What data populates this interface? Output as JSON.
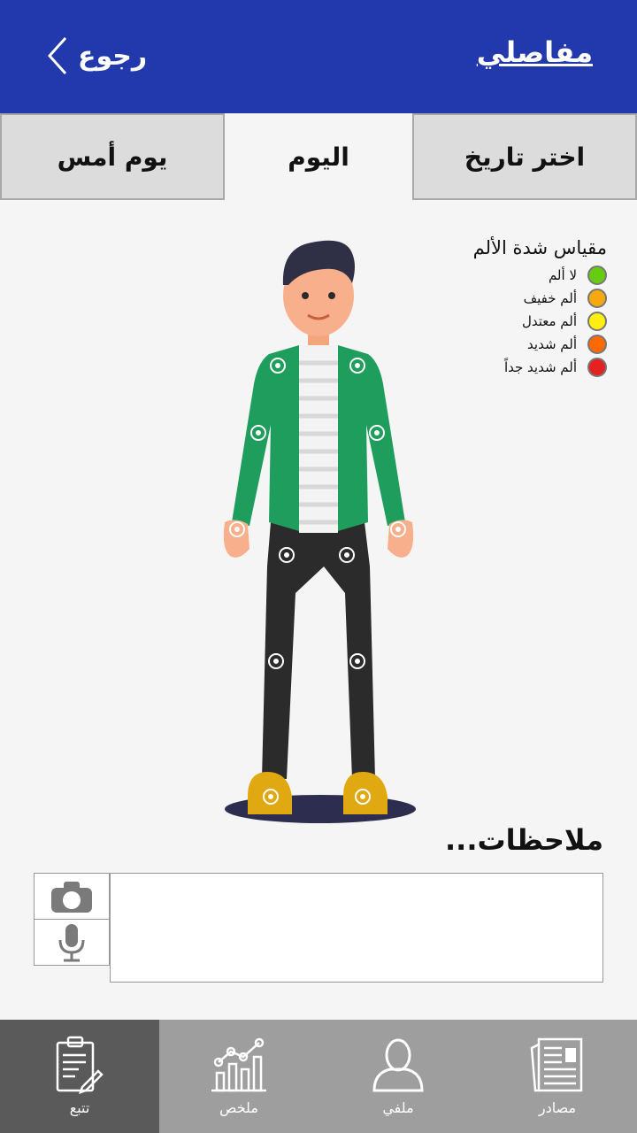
{
  "header": {
    "title": "مفاصلي",
    "back_label": "رجوع"
  },
  "tabs": [
    {
      "label": "اختر تاريخ",
      "active": false
    },
    {
      "label": "اليوم",
      "active": true
    },
    {
      "label": "يوم أمس",
      "active": false
    }
  ],
  "legend": {
    "title": "مقياس شدة الألم",
    "items": [
      {
        "label": "لا ألم",
        "color": "#66cc11"
      },
      {
        "label": "ألم خفيف",
        "color": "#f6a90e"
      },
      {
        "label": "ألم معتدل",
        "color": "#ffee11"
      },
      {
        "label": "ألم شديد",
        "color": "#ff6a00"
      },
      {
        "label": "ألم شديد جداً",
        "color": "#e52222"
      }
    ]
  },
  "notes": {
    "label": "ملاحظات..."
  },
  "nav": [
    {
      "label": "مصادر",
      "icon": "newspaper-icon",
      "active": false
    },
    {
      "label": "ملفي",
      "icon": "user-icon",
      "active": false
    },
    {
      "label": "ملخص",
      "icon": "chart-icon",
      "active": false
    },
    {
      "label": "تتبع",
      "icon": "clipboard-edit-icon",
      "active": true
    }
  ],
  "colors": {
    "header": "#2239ae",
    "jacket": "#1e9d5c",
    "pants": "#2b2b2b",
    "shoes": "#e0a912"
  }
}
